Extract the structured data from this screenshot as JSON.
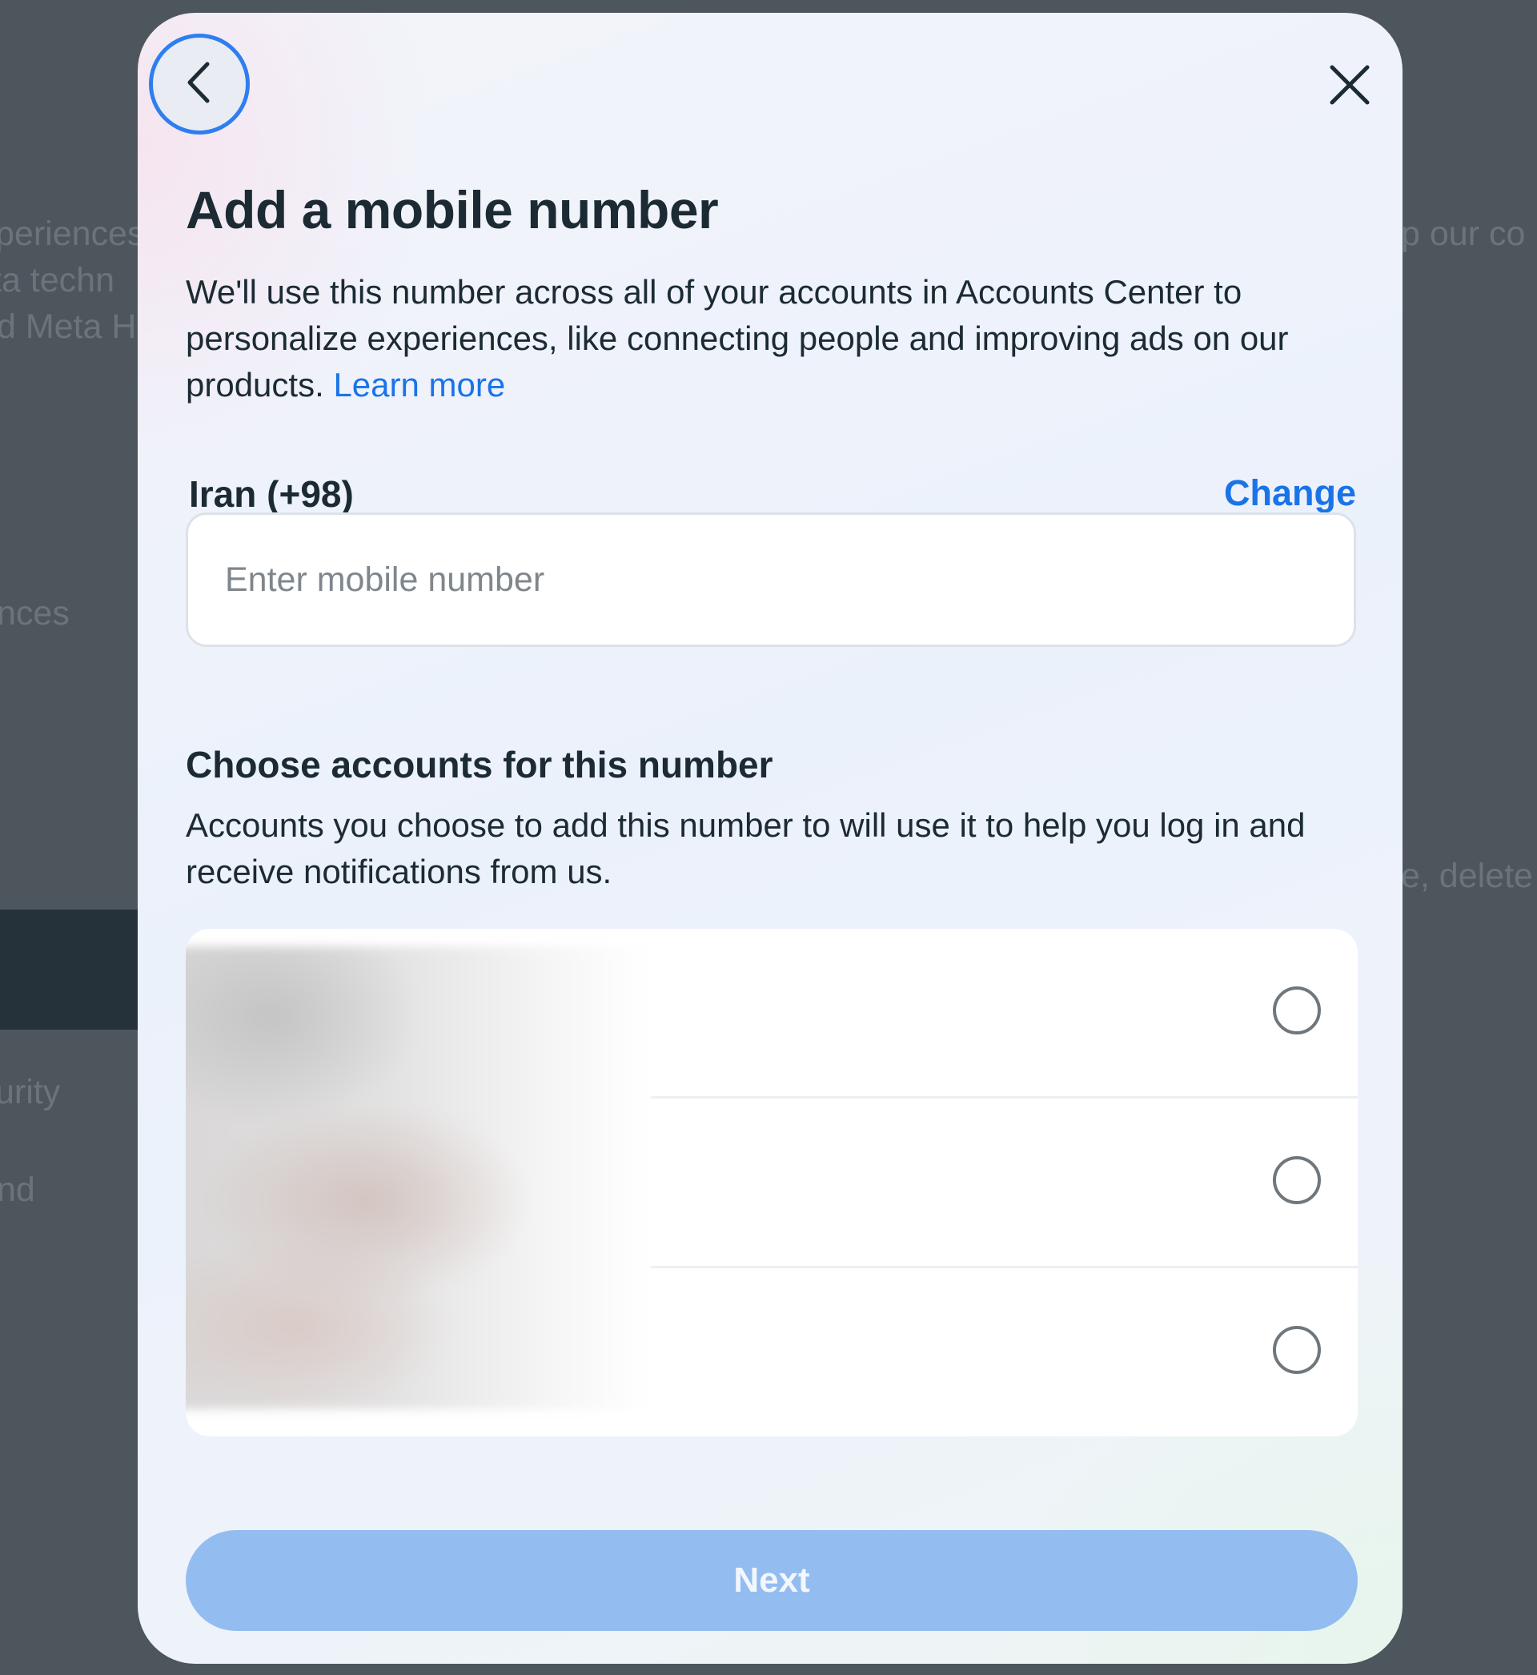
{
  "background": {
    "left_snippets": [
      "periences",
      "ta techn",
      "d Meta H",
      "nces",
      "urity",
      "nd"
    ],
    "right_snippets": [
      "p our co",
      "e, delete"
    ]
  },
  "modal": {
    "back_icon": "chevron-left-icon",
    "close_icon": "close-icon",
    "title": "Add a mobile number",
    "description": "We'll use this number across all of your accounts in Accounts Center to personalize experiences, like connecting people and improving ads on our products. ",
    "learn_more": "Learn more",
    "country": "Iran (+98)",
    "change_label": "Change",
    "phone_input": {
      "value": "",
      "placeholder": "Enter mobile number"
    },
    "accounts_section": {
      "title": "Choose accounts for this number",
      "description": "Accounts you choose to add this number to will use it to help you log in and receive notifications from us.",
      "accounts": [
        {
          "selected": false
        },
        {
          "selected": false
        },
        {
          "selected": false
        }
      ]
    },
    "next_label": "Next"
  },
  "colors": {
    "accent": "#1a73e8",
    "next_button_disabled": "#93bdf0",
    "focus_ring": "#2f7ef0",
    "text_primary": "#1c2b33"
  }
}
